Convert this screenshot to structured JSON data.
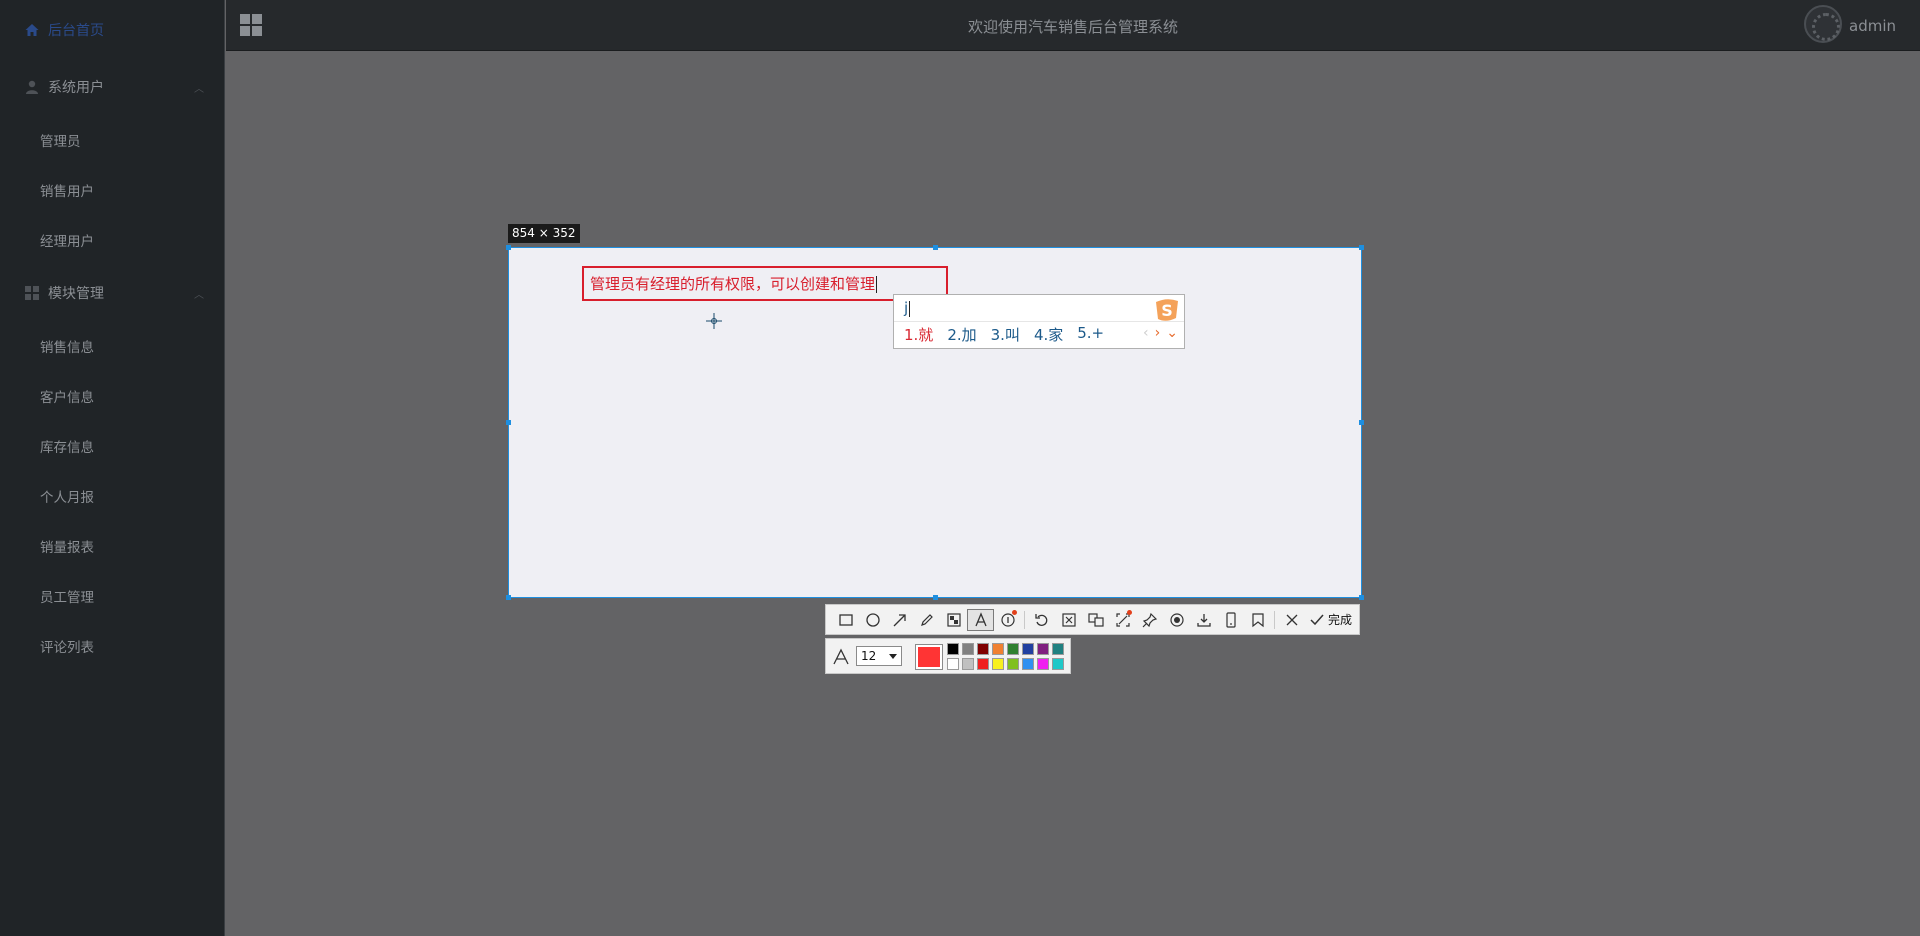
{
  "sidebar": {
    "home_label": "后台首页",
    "groups": [
      {
        "label": "系统用户",
        "items": [
          "管理员",
          "销售用户",
          "经理用户"
        ]
      },
      {
        "label": "模块管理",
        "items": [
          "销售信息",
          "客户信息",
          "库存信息",
          "个人月报",
          "销量报表",
          "员工管理",
          "评论列表"
        ]
      }
    ]
  },
  "header": {
    "title": "欢迎使用汽车销售后台管理系统",
    "username": "admin"
  },
  "capture": {
    "size_label": "854 × 352",
    "text_content": "管理员有经理的所有权限，可以创建和管理"
  },
  "ime": {
    "input": "j",
    "candidates": [
      "1.就",
      "2.加",
      "3.叫",
      "4.家",
      "5.+"
    ],
    "logo_icon": "sogou-logo-icon"
  },
  "toolbar": {
    "done_label": "完成",
    "tools": [
      "rectangle-icon",
      "ellipse-icon",
      "arrow-icon",
      "pen-icon",
      "mosaic-icon",
      "text-icon",
      "number-icon",
      "undo-icon",
      "ocr-icon",
      "translate-icon",
      "long-screenshot-icon",
      "pin-icon",
      "record-icon",
      "download-icon",
      "phone-icon",
      "bookmark-icon",
      "close-icon",
      "check-icon"
    ]
  },
  "stylebar": {
    "font_size": "12",
    "current_color": "#ff3434",
    "palette": [
      "#000000",
      "#808080",
      "#800000",
      "#f08030",
      "#308030",
      "#2040a0",
      "#802080",
      "#208080",
      "#ffffff",
      "#c0c0c0",
      "#f02020",
      "#f8f020",
      "#80c020",
      "#3090f0",
      "#f020f0",
      "#20c8c8"
    ]
  }
}
